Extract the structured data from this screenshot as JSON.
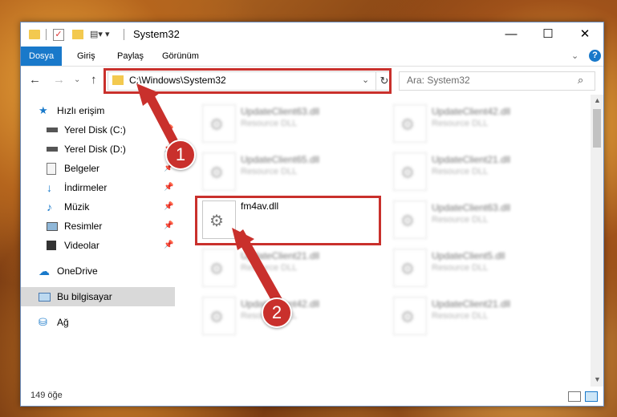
{
  "window": {
    "title": "System32",
    "controls": {
      "minimize": "—",
      "maximize": "☐",
      "close": "✕"
    }
  },
  "ribbon": {
    "tabs": [
      "Dosya",
      "Giriş",
      "Paylaş",
      "Görünüm"
    ],
    "help": "?"
  },
  "address": {
    "path": "C:\\Windows\\System32"
  },
  "search": {
    "placeholder": "Ara: System32"
  },
  "sidebar": {
    "items": [
      {
        "label": "Hızlı erişim",
        "icon": "star-icon",
        "pinned": false
      },
      {
        "label": "Yerel Disk (C:)",
        "icon": "drive-icon",
        "pinned": true
      },
      {
        "label": "Yerel Disk (D:)",
        "icon": "drive-icon",
        "pinned": true
      },
      {
        "label": "Belgeler",
        "icon": "documents-icon",
        "pinned": true
      },
      {
        "label": "İndirmeler",
        "icon": "download-icon",
        "pinned": true
      },
      {
        "label": "Müzik",
        "icon": "music-icon",
        "pinned": true
      },
      {
        "label": "Resimler",
        "icon": "pictures-icon",
        "pinned": true
      },
      {
        "label": "Videolar",
        "icon": "video-icon",
        "pinned": true
      },
      {
        "label": "OneDrive",
        "icon": "cloud-icon",
        "pinned": false
      },
      {
        "label": "Bu bilgisayar",
        "icon": "computer-icon",
        "pinned": false
      },
      {
        "label": "Ağ",
        "icon": "network-icon",
        "pinned": false
      }
    ]
  },
  "files": [
    {
      "name": "UpdateClient63.dll",
      "desc": "Resource DLL",
      "blurred": true
    },
    {
      "name": "UpdateClient42.dll",
      "desc": "Resource DLL",
      "blurred": true
    },
    {
      "name": "UpdateClient65.dll",
      "desc": "Resource DLL",
      "blurred": true
    },
    {
      "name": "UpdateClient21.dll",
      "desc": "Resource DLL",
      "blurred": true
    },
    {
      "name": "fm4av.dll",
      "desc": "",
      "blurred": false
    },
    {
      "name": "UpdateClient63.dll",
      "desc": "Resource DLL",
      "blurred": true
    },
    {
      "name": "UpdateClient21.dll",
      "desc": "Resource DLL",
      "blurred": true
    },
    {
      "name": "UpdateClient5.dll",
      "desc": "Resource DLL",
      "blurred": true
    },
    {
      "name": "UpdateClient42.dll",
      "desc": "Resource DLL",
      "blurred": true
    },
    {
      "name": "UpdateClient21.dll",
      "desc": "Resource DLL",
      "blurred": true
    }
  ],
  "status": {
    "count": "149 öğe"
  },
  "annotations": {
    "step1": "1",
    "step2": "2",
    "color": "#c9302c"
  }
}
